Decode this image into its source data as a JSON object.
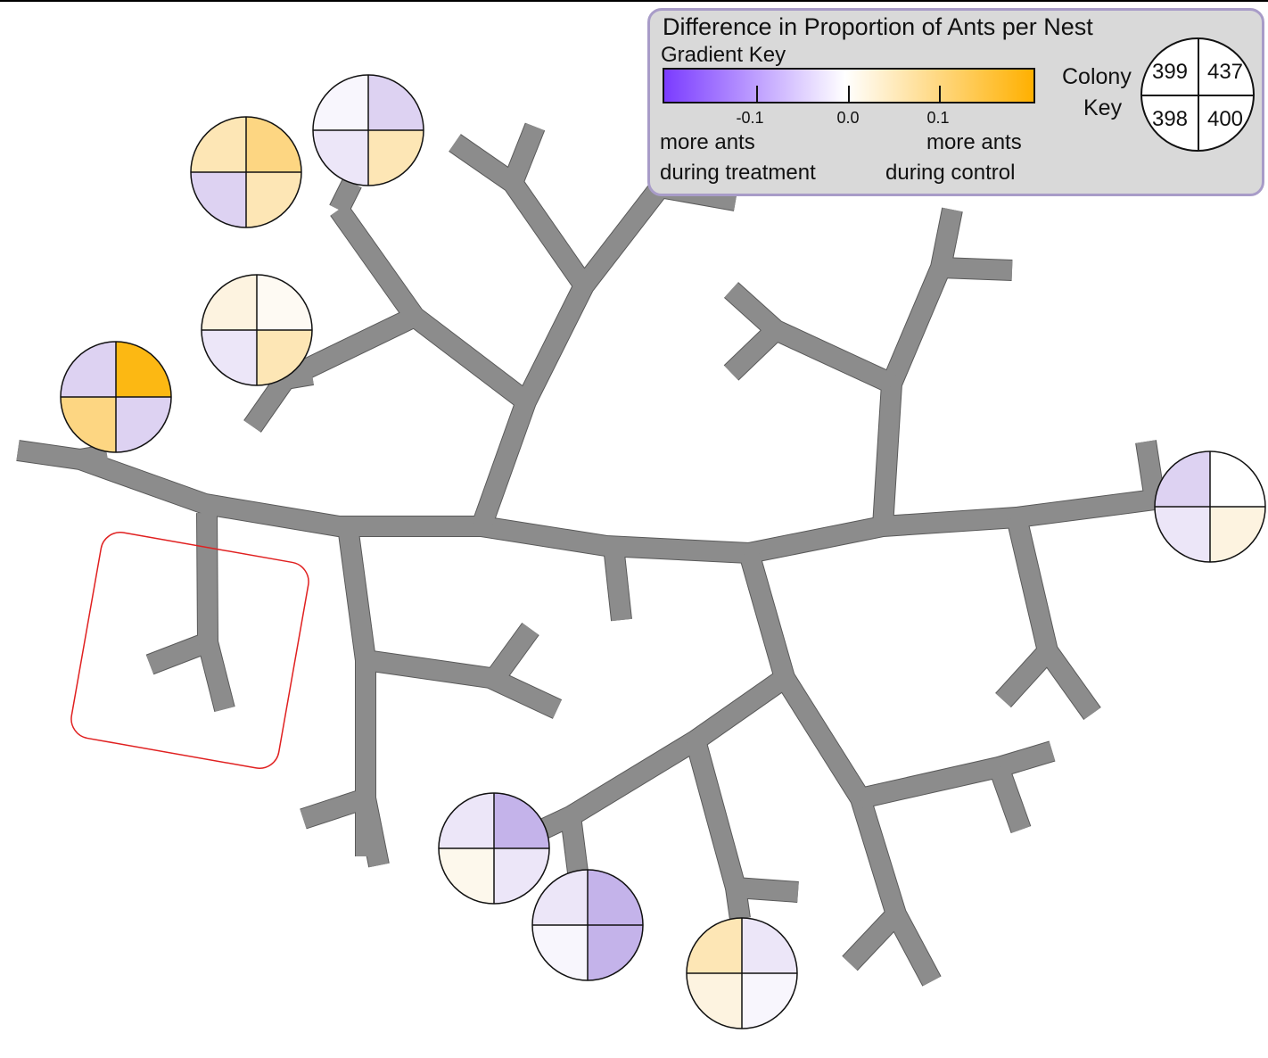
{
  "key": {
    "title": "Difference in Proportion of Ants per Nest",
    "gradient_label": "Gradient Key",
    "ticks": [
      "-0.1",
      "0.0",
      "0.1"
    ],
    "left_label_1": "more ants",
    "left_label_2": "during treatment",
    "right_label_1": "more ants",
    "right_label_2": "during control",
    "colony_label_1": "Colony",
    "colony_label_2": "Key",
    "colony_ids": {
      "top_left": "399",
      "top_right": "437",
      "bottom_left": "398",
      "bottom_right": "400"
    },
    "gradient_colors": {
      "treatment_end": "#7b3cff",
      "neutral": "#ffffff",
      "control_end": "#ffb000"
    }
  },
  "colors": {
    "tunnel_fill": "#8c8c8c",
    "tunnel_edge": "#5a5a5a",
    "highlight_box": "#e02020",
    "strong_purple": "#c4b3ea",
    "light_purple": "#ddd2f2",
    "faint_purple": "#ece6f8",
    "near_white": "#f8f6fd",
    "faint_orange": "#fdf3e0",
    "light_orange": "#fde6b5",
    "mid_orange": "#fdd682",
    "strong_orange": "#fcb813"
  },
  "nests": [
    {
      "name": "nest-top-a",
      "q": [
        "near_white",
        "light_purple",
        "faint_purple",
        "light_orange"
      ]
    },
    {
      "name": "nest-top-b",
      "q": [
        "light_orange",
        "mid_orange",
        "light_purple",
        "light_orange"
      ]
    },
    {
      "name": "nest-mid-left",
      "q": [
        "faint_orange",
        "#fefaf3",
        "faint_purple",
        "light_orange"
      ]
    },
    {
      "name": "nest-far-left",
      "q": [
        "light_purple",
        "strong_orange",
        "mid_orange",
        "light_purple"
      ]
    },
    {
      "name": "nest-right",
      "q": [
        "light_purple",
        "#ffffff",
        "faint_purple",
        "faint_orange"
      ]
    },
    {
      "name": "nest-bottom-a",
      "q": [
        "faint_purple",
        "strong_purple",
        "#fdf8ec",
        "faint_purple"
      ]
    },
    {
      "name": "nest-bottom-b",
      "q": [
        "faint_purple",
        "strong_purple",
        "near_white",
        "strong_purple"
      ]
    },
    {
      "name": "nest-bottom-c",
      "q": [
        "light_orange",
        "faint_purple",
        "faint_orange",
        "near_white"
      ]
    }
  ]
}
